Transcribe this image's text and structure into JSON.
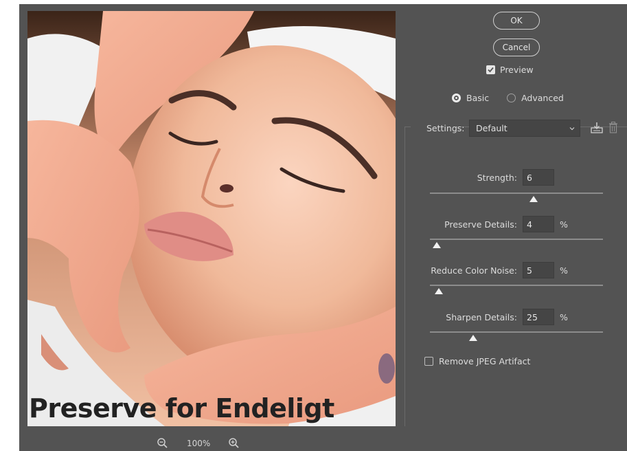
{
  "dialog": {
    "ok_label": "OK",
    "cancel_label": "Cancel",
    "preview_label": "Preview",
    "preview_checked": true,
    "mode": {
      "basic_label": "Basic",
      "advanced_label": "Advanced",
      "selected": "Basic"
    },
    "settings": {
      "label": "Settings:",
      "value": "Default",
      "save_icon": "save-settings-icon",
      "delete_icon": "trash-icon"
    },
    "params": [
      {
        "label": "Strength:",
        "value": "6",
        "unit": "",
        "fraction": 0.6
      },
      {
        "label": "Preserve Details:",
        "value": "4",
        "unit": "%",
        "fraction": 0.04
      },
      {
        "label": "Reduce Color Noise:",
        "value": "5",
        "unit": "%",
        "fraction": 0.05
      },
      {
        "label": "Sharpen Details:",
        "value": "25",
        "unit": "%",
        "fraction": 0.25
      }
    ],
    "remove_jpeg_label": "Remove JPEG Artifact",
    "remove_jpeg_checked": false
  },
  "preview": {
    "overlay_text": "Preserve for Endeligt"
  },
  "zoom": {
    "level": "100%",
    "zoom_out_icon": "zoom-out-icon",
    "zoom_in_icon": "zoom-in-icon"
  },
  "colors": {
    "panel_bg": "#535353",
    "field_bg": "#454545",
    "text": "#dcdcdc"
  }
}
